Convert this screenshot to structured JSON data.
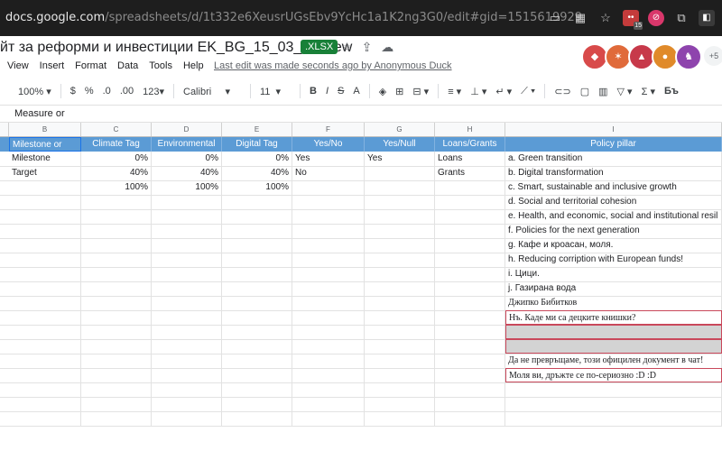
{
  "browser": {
    "url_host": "docs.google.com",
    "url_path": "/spreadsheets/d/1t332e6XeusrUGsEbv9YcHc1a1K2ng3G0/edit#gid=1515619929",
    "badge_count": "15"
  },
  "doc": {
    "title": "йт за реформи и инвестиции EK_BG_15_03_21_new",
    "format_badge": ".XLSX",
    "last_edit": "Last edit was made seconds ago by Anonymous Duck",
    "collaborators_more": "+5"
  },
  "menu": [
    "View",
    "Insert",
    "Format",
    "Data",
    "Tools",
    "Help"
  ],
  "toolbar": {
    "zoom": "100%",
    "currency": "$",
    "percent": "%",
    "dec_less": ".0",
    "dec_more": ".00",
    "more_formats": "123",
    "font": "Calibri",
    "font_size": "11",
    "bold": "B",
    "italic": "I",
    "strike": "S",
    "text_color": "A",
    "sum": "Σ",
    "lang": "Бъ"
  },
  "formula": {
    "value": "Measure or"
  },
  "columns": [
    "B",
    "C",
    "D",
    "E",
    "F",
    "G",
    "H",
    "I"
  ],
  "header_row": [
    "Milestone or",
    "Climate Tag",
    "Environmental",
    "Digital Tag",
    "Yes/No",
    "Yes/Null",
    "Loans/Grants",
    "Policy pillar"
  ],
  "rows": [
    {
      "b": "Milestone",
      "c": "0%",
      "d": "0%",
      "e": "0%",
      "f": "Yes",
      "g": "Yes",
      "h": "Loans",
      "i": "a. Green transition"
    },
    {
      "b": "Target",
      "c": "40%",
      "d": "40%",
      "e": "40%",
      "f": "No",
      "g": "",
      "h": "Grants",
      "i": "b. Digital transformation"
    },
    {
      "b": "",
      "c": "100%",
      "d": "100%",
      "e": "100%",
      "f": "",
      "g": "",
      "h": "",
      "i": "c. Smart, sustainable and inclusive growth"
    },
    {
      "b": "",
      "c": "",
      "d": "",
      "e": "",
      "f": "",
      "g": "",
      "h": "",
      "i": "d. Social and territorial cohesion"
    },
    {
      "b": "",
      "c": "",
      "d": "",
      "e": "",
      "f": "",
      "g": "",
      "h": "",
      "i": "e. Health, and economic, social and institutional resil"
    },
    {
      "b": "",
      "c": "",
      "d": "",
      "e": "",
      "f": "",
      "g": "",
      "h": "",
      "i": "f. Policies for the next generation"
    },
    {
      "b": "",
      "c": "",
      "d": "",
      "e": "",
      "f": "",
      "g": "",
      "h": "",
      "i": "g. Кафе и кроасан, моля."
    },
    {
      "b": "",
      "c": "",
      "d": "",
      "e": "",
      "f": "",
      "g": "",
      "h": "",
      "i": "h. Reducing corription with European funds!"
    },
    {
      "b": "",
      "c": "",
      "d": "",
      "e": "",
      "f": "",
      "g": "",
      "h": "",
      "i": "i. Цици."
    },
    {
      "b": "",
      "c": "",
      "d": "",
      "e": "",
      "f": "",
      "g": "",
      "h": "",
      "i": "j. Газирана вода"
    },
    {
      "b": "",
      "c": "",
      "d": "",
      "e": "",
      "f": "",
      "g": "",
      "h": "",
      "i": "Джипко Бибитков"
    },
    {
      "b": "",
      "c": "",
      "d": "",
      "e": "",
      "f": "",
      "g": "",
      "h": "",
      "i": "Нъ. Каде ми са децките книшки?"
    },
    {
      "b": "",
      "c": "",
      "d": "",
      "e": "",
      "f": "",
      "g": "",
      "h": "",
      "i": ""
    },
    {
      "b": "",
      "c": "",
      "d": "",
      "e": "",
      "f": "",
      "g": "",
      "h": "",
      "i": ""
    },
    {
      "b": "",
      "c": "",
      "d": "",
      "e": "",
      "f": "",
      "g": "",
      "h": "",
      "i": "Да не превръщаме, този официлен документ в чат!"
    },
    {
      "b": "",
      "c": "",
      "d": "",
      "e": "",
      "f": "",
      "g": "",
      "h": "",
      "i": "Моля ви, дръжте се по-сериозно :D :D"
    },
    {
      "b": "",
      "c": "",
      "d": "",
      "e": "",
      "f": "",
      "g": "",
      "h": "",
      "i": ""
    },
    {
      "b": "",
      "c": "",
      "d": "",
      "e": "",
      "f": "",
      "g": "",
      "h": "",
      "i": ""
    },
    {
      "b": "",
      "c": "",
      "d": "",
      "e": "",
      "f": "",
      "g": "",
      "h": "",
      "i": ""
    }
  ],
  "colors": {
    "header_blue": "#5b9bd5",
    "xlsx_green": "#188038",
    "highlight_border": "#c9485b",
    "gray_fill": "#d3d3d3"
  }
}
